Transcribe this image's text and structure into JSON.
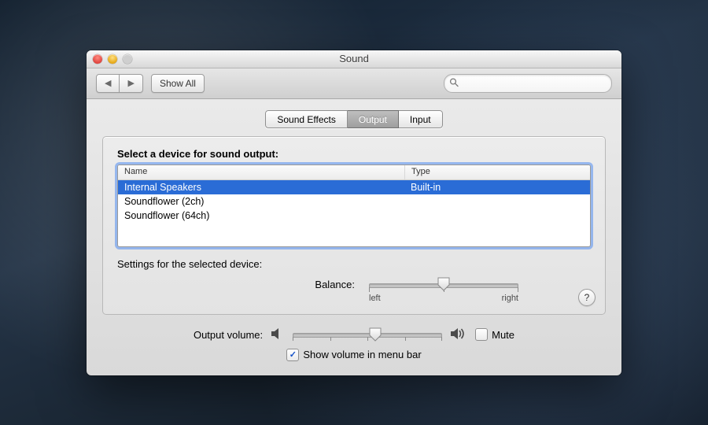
{
  "window": {
    "title": "Sound"
  },
  "toolbar": {
    "back_glyph": "◀",
    "fwd_glyph": "▶",
    "show_all": "Show All",
    "search_placeholder": ""
  },
  "tabs": [
    "Sound Effects",
    "Output",
    "Input"
  ],
  "active_tab_index": 1,
  "panel": {
    "heading": "Select a device for sound output:",
    "columns": {
      "name": "Name",
      "type": "Type"
    },
    "devices": [
      {
        "name": "Internal Speakers",
        "type": "Built-in",
        "selected": true
      },
      {
        "name": "Soundflower (2ch)",
        "type": "",
        "selected": false
      },
      {
        "name": "Soundflower (64ch)",
        "type": "",
        "selected": false
      }
    ],
    "settings_label": "Settings for the selected device:",
    "balance_label": "Balance:",
    "balance_left": "left",
    "balance_right": "right",
    "help_glyph": "?"
  },
  "volume": {
    "label": "Output volume:",
    "mute_label": "Mute",
    "mute_checked": false,
    "show_in_menu_label": "Show volume in menu bar",
    "show_in_menu_checked": true
  }
}
